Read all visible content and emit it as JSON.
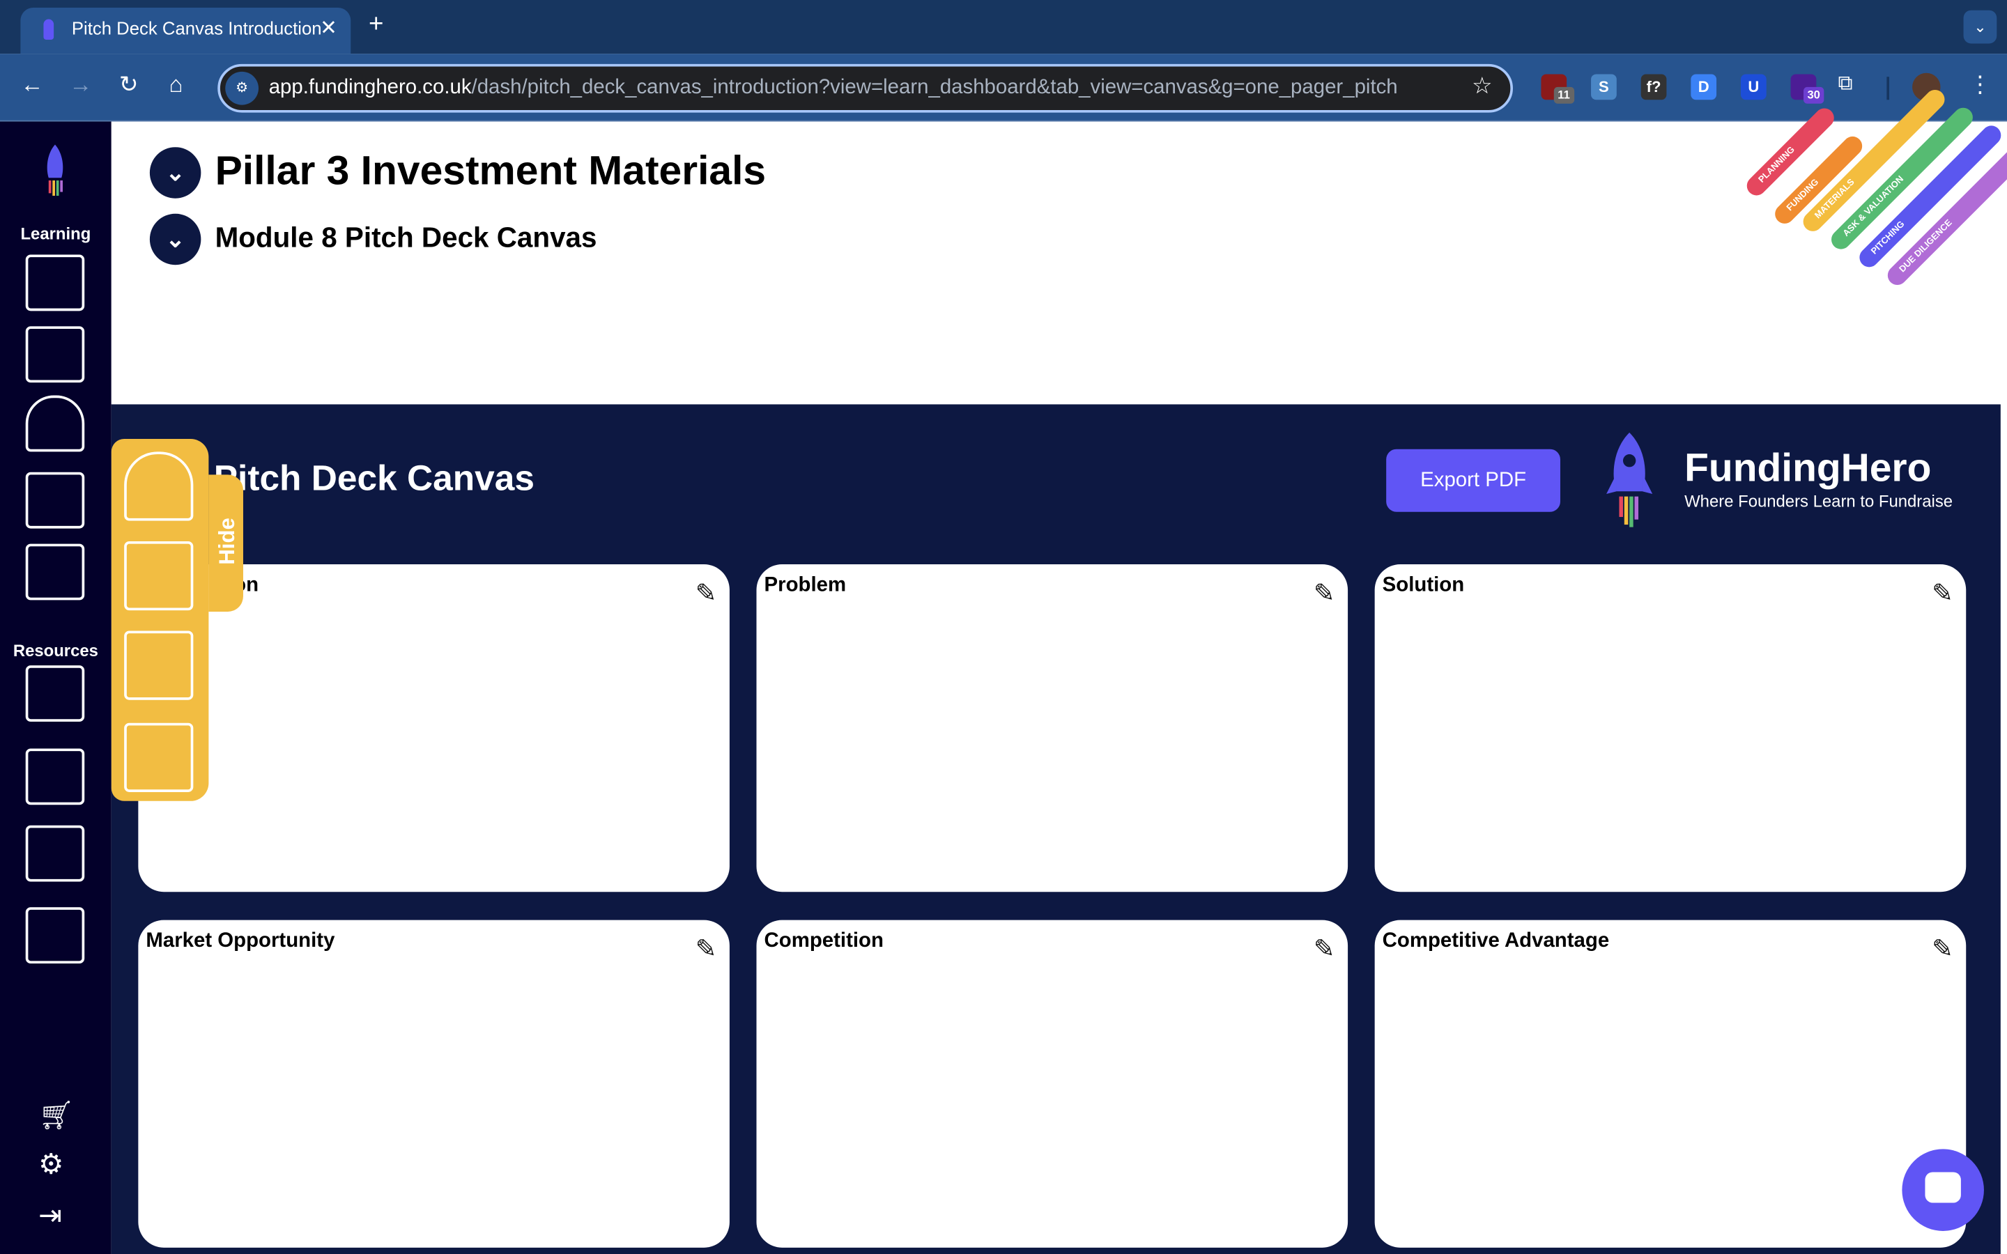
{
  "browser": {
    "tab_title": "Pitch Deck Canvas Introduction",
    "url_host": "app.fundinghero.co.uk",
    "url_path": "/dash/pitch_deck_canvas_introduction?view=learn_dashboard&tab_view=canvas&g=one_pager_pitch",
    "extensions": [
      {
        "name": "ublock-icon",
        "badge": "11",
        "color": "#8b1a1a"
      },
      {
        "name": "s-extension-icon",
        "glyph": "S",
        "color": "#4a86c5"
      },
      {
        "name": "formula-extension-icon",
        "glyph": "f?",
        "color": "#333333"
      },
      {
        "name": "d-extension-icon",
        "glyph": "D",
        "color": "#3b82f6"
      },
      {
        "name": "u-extension-icon",
        "glyph": "U",
        "color": "#1d4ed8"
      },
      {
        "name": "diamond-extension-icon",
        "badge": "30",
        "color": "#4c1d95"
      }
    ]
  },
  "sidebar": {
    "learning_label": "Learning",
    "resources_label": "Resources"
  },
  "header": {
    "pillar_title": "Pillar 3 Investment Materials",
    "module_title": "Module 8 Pitch Deck Canvas",
    "stripes": [
      {
        "label": "PLANNING",
        "color": "#e5475e"
      },
      {
        "label": "FUNDING",
        "color": "#f08c30"
      },
      {
        "label": "MATERIALS",
        "color": "#f4bd3e"
      },
      {
        "label": "ASK & VALUATION",
        "color": "#56bb72"
      },
      {
        "label": "PITCHING",
        "color": "#5b57ef"
      },
      {
        "label": "DUE DILIGENCE",
        "color": "#b06cd6"
      }
    ]
  },
  "canvas": {
    "title": "Pitch Deck Canvas",
    "export_label": "Export PDF",
    "brand_name": "FundingHero",
    "tagline": "Where Founders Learn to Fundraise",
    "cards": [
      {
        "label": "Description"
      },
      {
        "label": "Problem"
      },
      {
        "label": "Solution"
      },
      {
        "label": "Market Opportunity"
      },
      {
        "label": "Competition"
      },
      {
        "label": "Competitive Advantage"
      }
    ]
  },
  "panel": {
    "hide_label": "Hide"
  },
  "colors": {
    "accent": "#6055f5",
    "navy": "#0d1842",
    "sidebar": "#03002a",
    "yellow": "#f2bd42"
  }
}
